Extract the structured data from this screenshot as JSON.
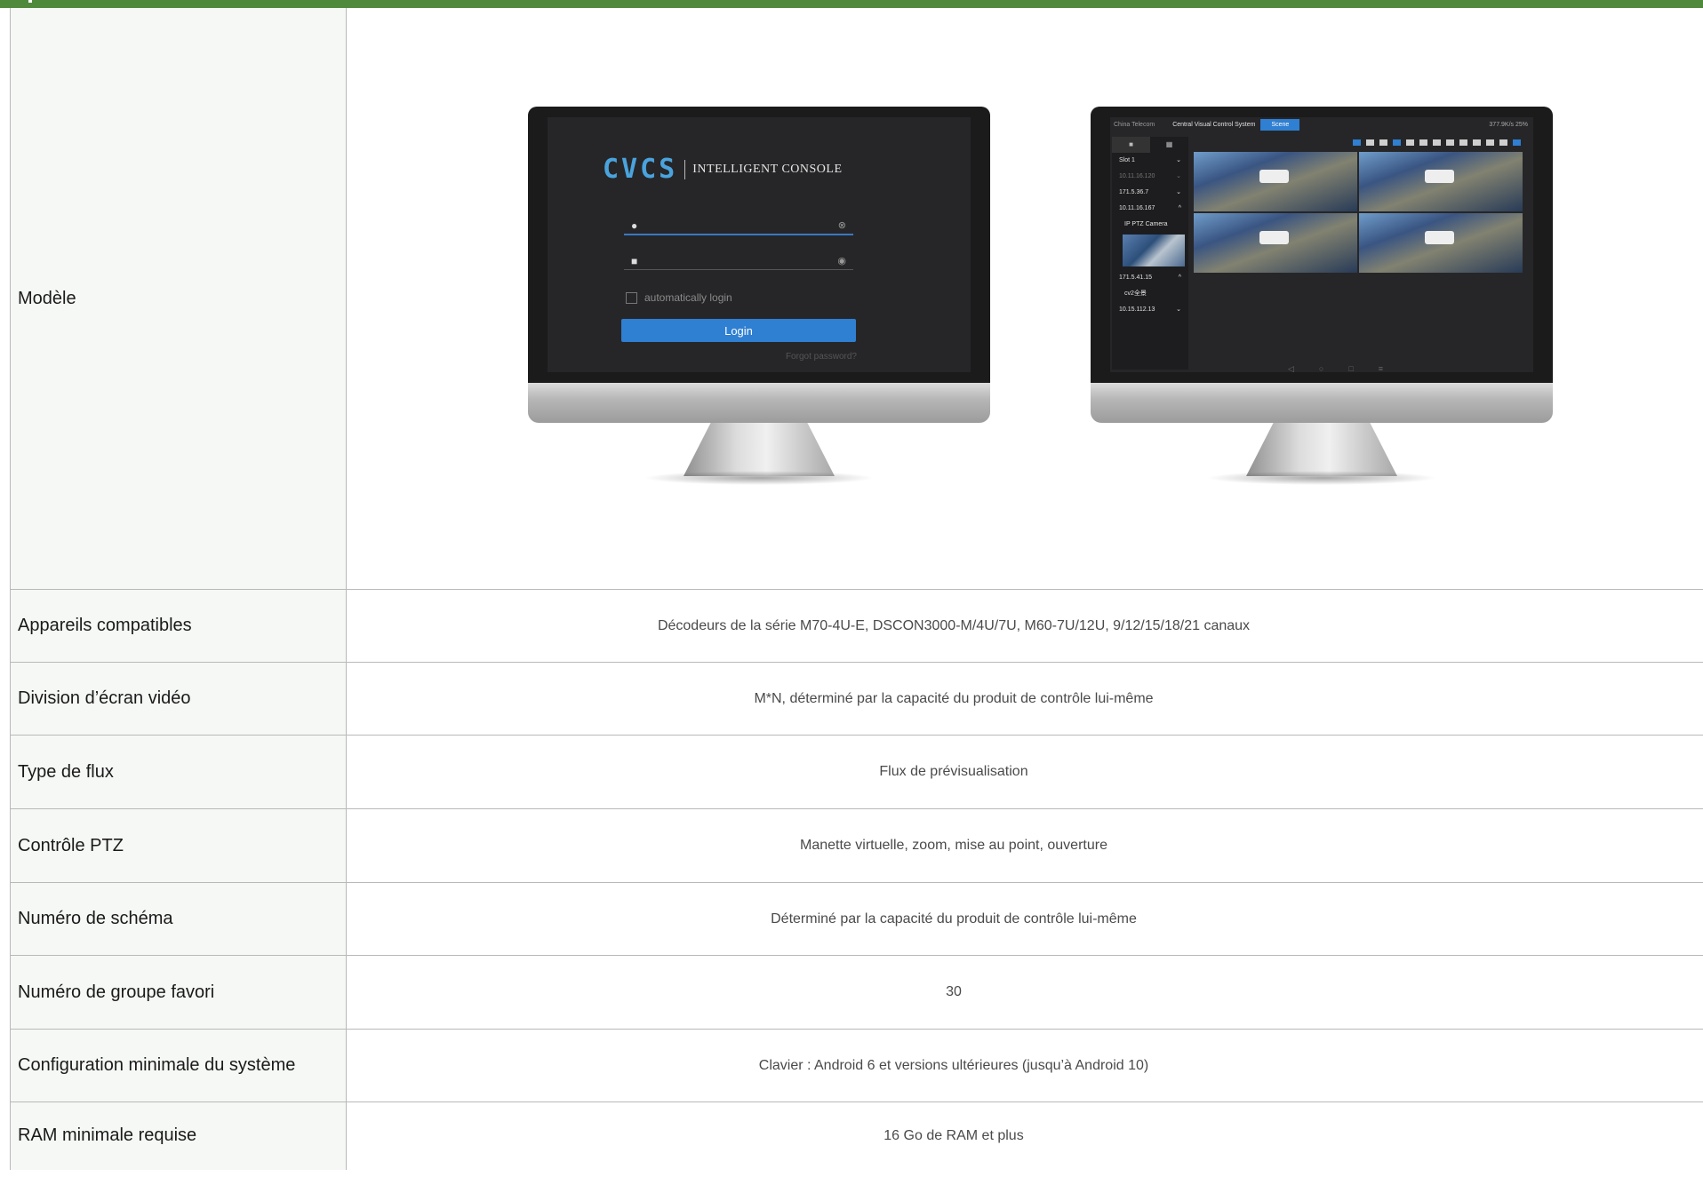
{
  "rows": [
    {
      "label": "Modèle"
    },
    {
      "label": "Appareils compatibles",
      "value": "Décodeurs de la série M70-4U-E, DSCON3000-M/4U/7U, M60-7U/12U, 9/12/15/18/21 canaux"
    },
    {
      "label": "Division d’écran vidéo",
      "value": "M*N, déterminé par la capacité du produit de contrôle lui-même"
    },
    {
      "label": "Type de flux",
      "value": "Flux de prévisualisation"
    },
    {
      "label": "Contrôle PTZ",
      "value": "Manette virtuelle, zoom, mise au point, ouverture"
    },
    {
      "label": "Numéro de schéma",
      "value": "Déterminé par la capacité du produit de contrôle lui-même"
    },
    {
      "label": "Numéro de groupe favori",
      "value": "30"
    },
    {
      "label": "Configuration minimale du système",
      "value": "Clavier : Android 6 et versions ultérieures (jusqu’à Android 10)"
    },
    {
      "label": "RAM minimale requise",
      "value": "16 Go de RAM et plus"
    }
  ],
  "login_screen": {
    "brand": "CVCS",
    "tagline": "INTELLIGENT CONSOLE",
    "auto_login": "automatically login",
    "login_button": "Login",
    "forgot": "Forgot password?"
  },
  "control_screen": {
    "carrier": "China Telecom",
    "title": "Central Visual Control System",
    "scene_tab": "Scene",
    "status": "377.9K/s 25%",
    "device_list": [
      {
        "label": "Slot 1",
        "chev": "⌄"
      },
      {
        "label": "10.11.16.120",
        "chev": "⌄"
      },
      {
        "label": "171.5.36.7",
        "chev": "⌄"
      },
      {
        "label": "10.11.16.167",
        "chev": "^"
      },
      {
        "label": "IP PTZ Camera",
        "chev": ""
      },
      {
        "label": "171.5.41.15",
        "chev": "^"
      },
      {
        "label": "cv2全景",
        "chev": ""
      },
      {
        "label": "10.15.112.13",
        "chev": "⌄"
      }
    ]
  },
  "colors": {
    "header_bar": "#4f8a3c",
    "label_bg": "#f5f8f4",
    "accent_blue": "#2f7fd2",
    "brand_blue": "#4aa3dd"
  }
}
